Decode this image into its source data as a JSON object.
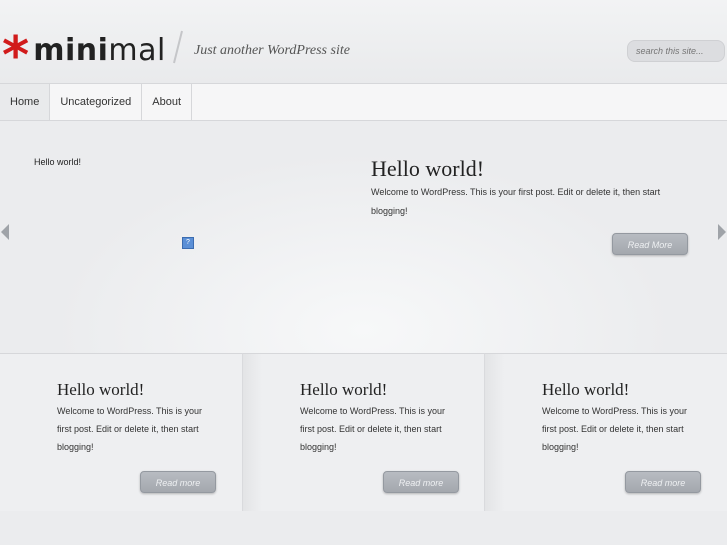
{
  "header": {
    "logo_star": "*",
    "logo_bold": "mini",
    "logo_rest": "mal",
    "tagline": "Just another WordPress site",
    "search_placeholder": "search this site..."
  },
  "nav": {
    "items": [
      {
        "label": "Home"
      },
      {
        "label": "Uncategorized"
      },
      {
        "label": "About"
      }
    ]
  },
  "featured": {
    "small_title": "Hello world!",
    "title": "Hello world!",
    "excerpt": "Welcome to WordPress. This is your first post. Edit or delete it, then start blogging!",
    "button": "Read More",
    "broken_image_glyph": "?"
  },
  "posts": [
    {
      "title": "Hello world!",
      "excerpt": "Welcome to WordPress. This is your first post. Edit or delete it, then start blogging!",
      "button": "Read more"
    },
    {
      "title": "Hello world!",
      "excerpt": "Welcome to WordPress. This is your first post. Edit or delete it, then start blogging!",
      "button": "Read more"
    },
    {
      "title": "Hello world!",
      "excerpt": "Welcome to WordPress. This is your first post. Edit or delete it, then start blogging!",
      "button": "Read more"
    }
  ],
  "colors": {
    "accent": "#d11b1b",
    "background": "#ebecee",
    "button": "#a9adb3"
  },
  "icons": [
    "slider-prev-arrow-icon",
    "slider-next-arrow-icon",
    "broken-image-icon"
  ]
}
